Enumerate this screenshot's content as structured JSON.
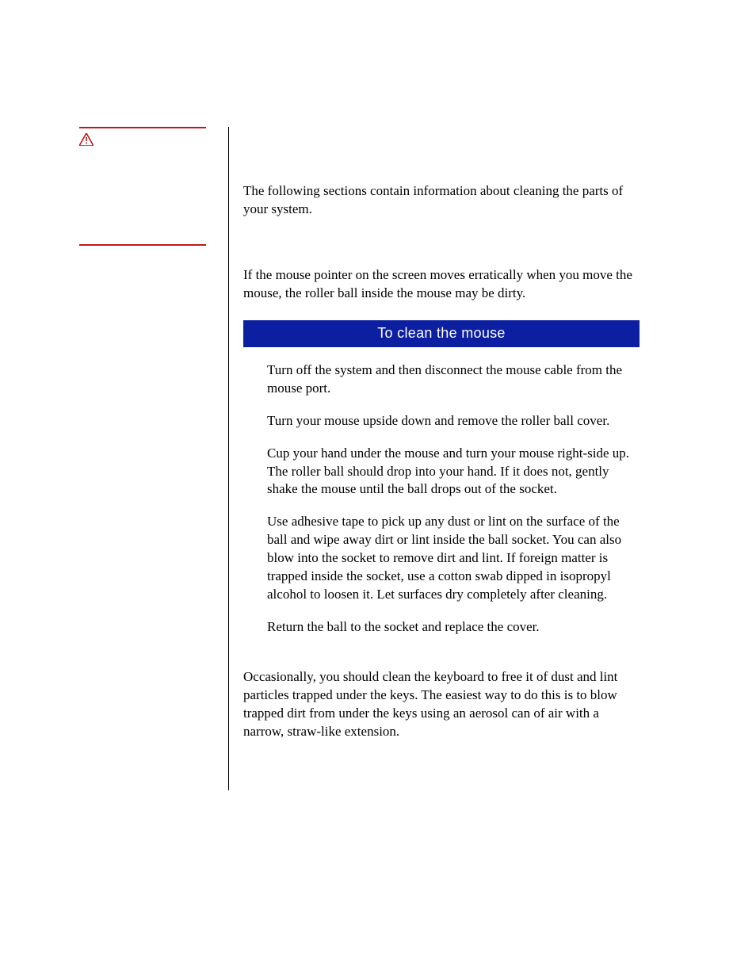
{
  "intro": "The following sections contain information about cleaning the parts of your system.",
  "mouse_intro": "If the mouse pointer on the screen moves erratically when you move the mouse, the roller ball inside the mouse may be dirty.",
  "banner": "To clean the mouse",
  "steps": [
    "Turn off the system and then disconnect the mouse cable from the mouse port.",
    "Turn your mouse upside down and remove the roller ball cover.",
    "Cup your hand under the mouse and turn your mouse right-side up. The roller ball should drop into your hand. If it does not, gently shake the mouse until the ball drops out of the socket.",
    "Use adhesive tape to pick up any dust or lint on the surface of the ball and wipe away dirt or lint inside the ball socket. You can also blow into the socket to remove dirt and lint. If foreign matter is trapped inside the socket, use a cotton swab dipped in isopropyl alcohol to loosen it. Let surfaces dry completely after cleaning.",
    "Return the ball to the socket and replace the cover."
  ],
  "keyboard_para": "Occasionally, you should clean the keyboard to free it of dust and lint particles trapped under the keys. The easiest way to do this is to blow trapped dirt from under the keys using an aerosol can of air with a narrow, straw-like extension."
}
